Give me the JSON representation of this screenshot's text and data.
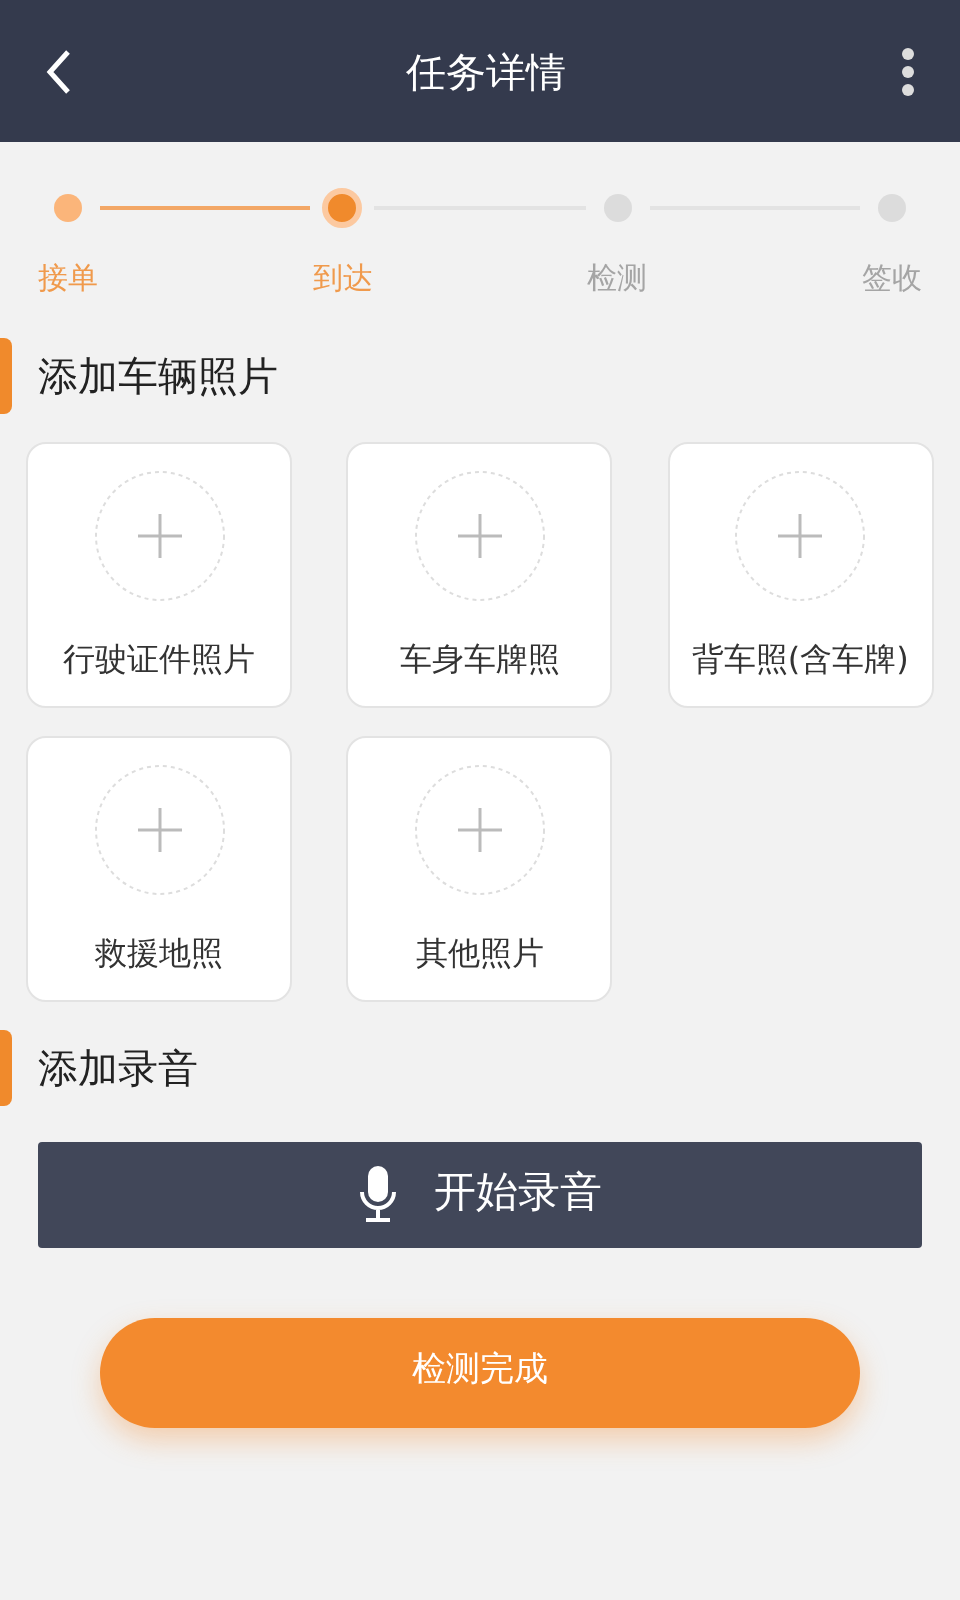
{
  "header": {
    "title": "任务详情"
  },
  "steps": [
    {
      "label": "接单",
      "kind": "done"
    },
    {
      "label": "到达",
      "kind": "current"
    },
    {
      "label": "检测",
      "kind": "pending"
    },
    {
      "label": "签收",
      "kind": "pending"
    }
  ],
  "photo_section": {
    "title": "添加车辆照片",
    "slots": [
      {
        "label": "行驶证件照片"
      },
      {
        "label": "车身车牌照"
      },
      {
        "label": "背车照(含车牌)"
      },
      {
        "label": "救援地照"
      },
      {
        "label": "其他照片"
      }
    ]
  },
  "audio_section": {
    "title": "添加录音",
    "record_button": "开始录音"
  },
  "submit_button": "检测完成"
}
